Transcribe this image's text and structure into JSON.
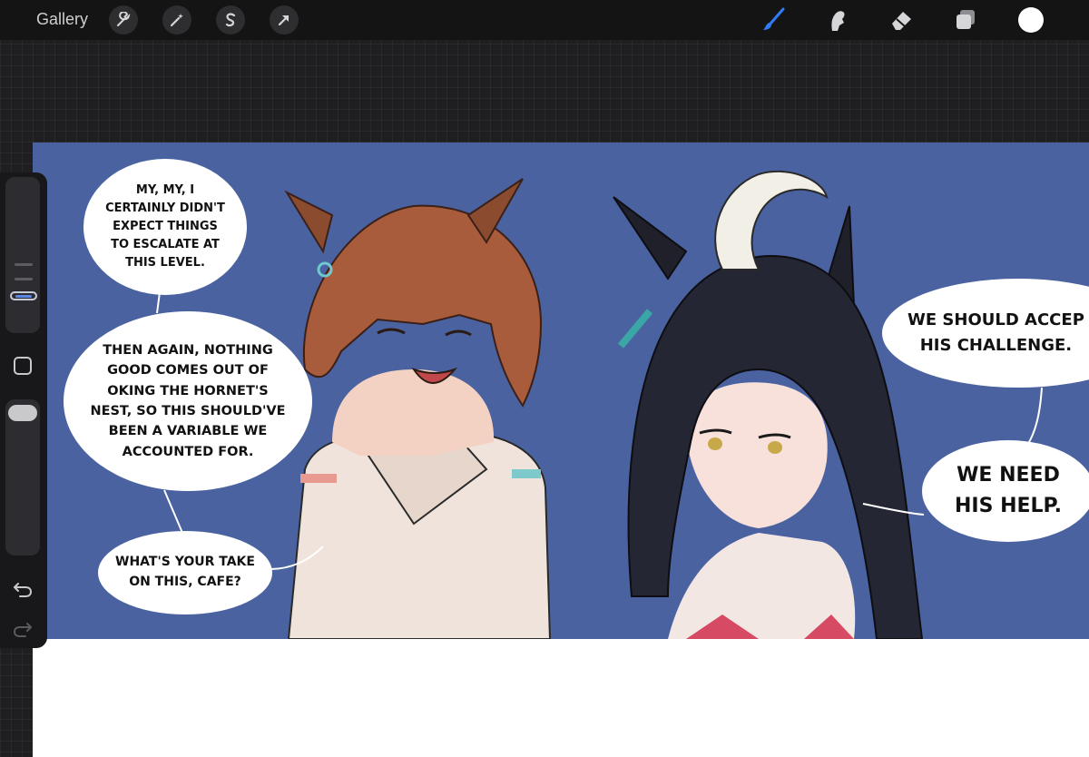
{
  "app": {
    "name": "Procreate"
  },
  "toolbar": {
    "gallery_label": "Gallery",
    "left_tools": [
      "wrench-icon",
      "magic-wand-icon",
      "selection-s-icon",
      "transform-arrow-icon"
    ],
    "right_tools": [
      "brush-icon",
      "smudge-icon",
      "eraser-icon",
      "layers-icon",
      "color-swatch"
    ],
    "active_tool": "brush-icon",
    "current_color": "#ffffff",
    "accent": "#2f7cf6"
  },
  "sidebar": {
    "brush_size_level": 0.1,
    "opacity_level": 0.95,
    "buttons": [
      "modify-square-icon",
      "undo-icon",
      "redo-icon"
    ]
  },
  "canvas": {
    "panel_background": "#4a62a0",
    "bubbles": [
      {
        "text": "My, my, I certainly didn't expect things to escalate at this level.",
        "lines": [
          "My, my, I",
          "certainly didn't",
          "expect things",
          "to escalate at",
          "this level."
        ]
      },
      {
        "text": "Then again, nothing good comes out of oking the hornet's nest, so this should've been a variable we accounted for.",
        "lines": [
          "Then again, nothing",
          "good comes out of",
          "oking the hornet's",
          "nest, so this should've",
          "been a variable we",
          "accounted for."
        ]
      },
      {
        "text": "What's your take on this, Cafe?",
        "lines": [
          "What's your take",
          "on this, Cafe?"
        ]
      },
      {
        "text": "We should accep his challenge.",
        "lines": [
          "We should accep",
          "his challenge."
        ]
      },
      {
        "text": "We need his help.",
        "lines": [
          "We need",
          "his help."
        ]
      }
    ]
  }
}
